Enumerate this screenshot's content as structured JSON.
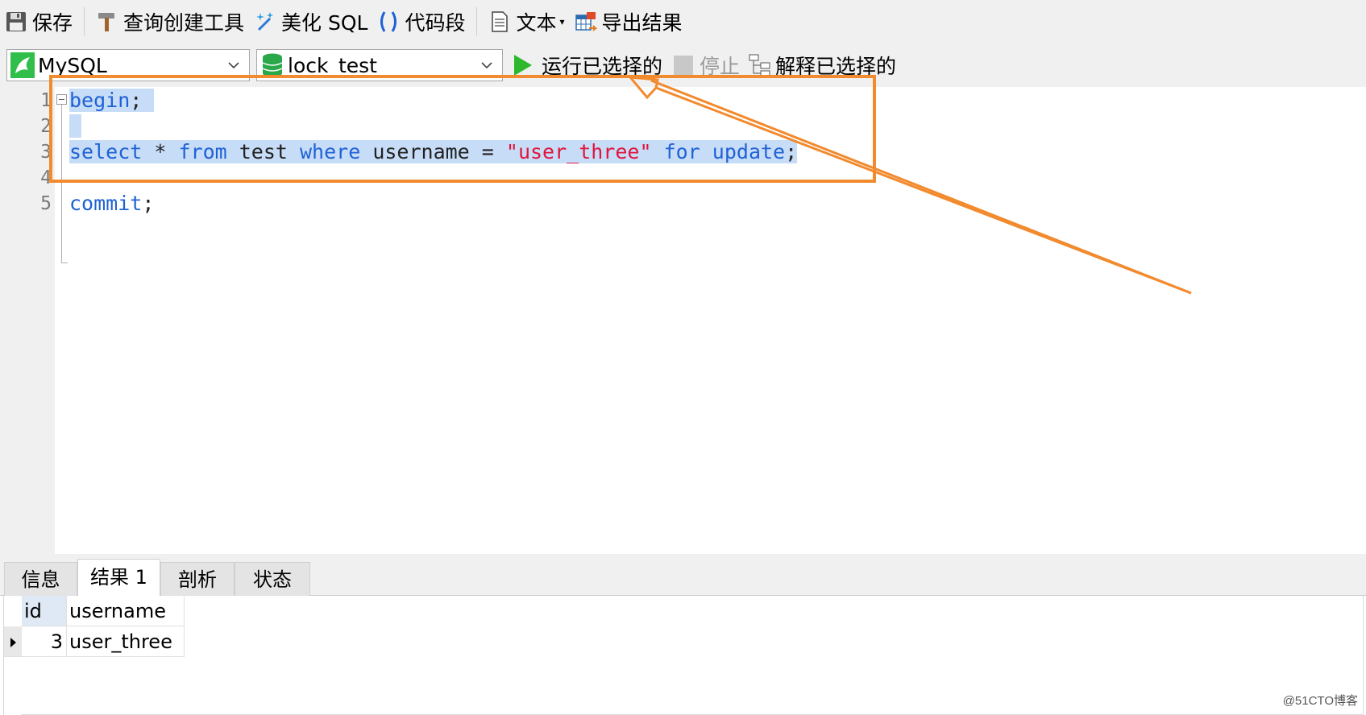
{
  "toolbar": {
    "save_label": "保存",
    "query_builder_label": "查询创建工具",
    "beautify_label": "美化 SQL",
    "snippet_label": "代码段",
    "text_label": "文本",
    "export_label": "导出结果",
    "icons": {
      "save": "save-disk-icon",
      "query_builder": "hammer-icon",
      "beautify": "magic-wand-icon",
      "snippet": "parentheses-icon",
      "text": "document-icon",
      "export": "table-export-icon"
    }
  },
  "connection_select": {
    "value": "MySQL",
    "icon": "mysql-dolphin-icon"
  },
  "database_select": {
    "value": "lock_test",
    "icon": "database-icon"
  },
  "run_selected_label": "运行已选择的",
  "stop_label": "停止",
  "explain_selected_label": "解释已选择的",
  "editor": {
    "line_numbers": [
      "1",
      "2",
      "3",
      "4",
      "5"
    ],
    "lines": {
      "l1_kw": "begin",
      "l1_punct": ";",
      "l3_select": "select",
      "l3_star": " * ",
      "l3_from": "from",
      "l3_table": " test ",
      "l3_where": "where",
      "l3_col": " username = ",
      "l3_str": "\"user_three\"",
      "l3_sp": " ",
      "l3_for": "for",
      "l3_sp2": " ",
      "l3_update": "update",
      "l3_punct": ";",
      "l5_kw": "commit",
      "l5_punct": ";"
    }
  },
  "results": {
    "tabs": [
      "信息",
      "结果 1",
      "剖析",
      "状态"
    ],
    "active_tab": "结果 1",
    "columns": [
      "id",
      "username"
    ],
    "rows": [
      {
        "id": "3",
        "username": "user_three"
      }
    ]
  },
  "watermark": "@51CTO博客",
  "colors": {
    "keyword": "#1f62d6",
    "string": "#e0143c",
    "selection": "#c7dcf7",
    "annotation": "#f28a2e",
    "run_green": "#2db82d"
  }
}
